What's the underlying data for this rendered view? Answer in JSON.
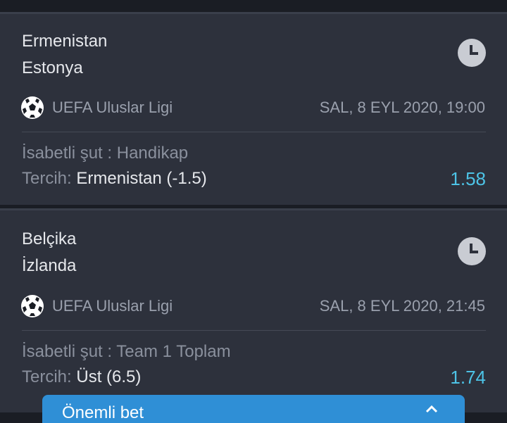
{
  "matches": [
    {
      "team1": "Ermenistan",
      "team2": "Estonya",
      "league": "UEFA Uluslar Ligi",
      "datetime": "SAL, 8 EYL 2020, 19:00",
      "market": "İsabetli şut : Handikap",
      "preference_label": "Tercih:",
      "preference_value": "Ermenistan (-1.5)",
      "odds": "1.58"
    },
    {
      "team1": "Belçika",
      "team2": "İzlanda",
      "league": "UEFA Uluslar Ligi",
      "datetime": "SAL, 8 EYL 2020, 21:45",
      "market": "İsabetli şut : Team 1 Toplam",
      "preference_label": "Tercih:",
      "preference_value": "Üst (6.5)",
      "odds": "1.74"
    }
  ],
  "bottom_bar": {
    "label": "Önemli bet"
  },
  "colors": {
    "background": "#1a1d24",
    "card": "#2d313c",
    "odds": "#4dc3e6",
    "accent": "#2f8fd6"
  }
}
